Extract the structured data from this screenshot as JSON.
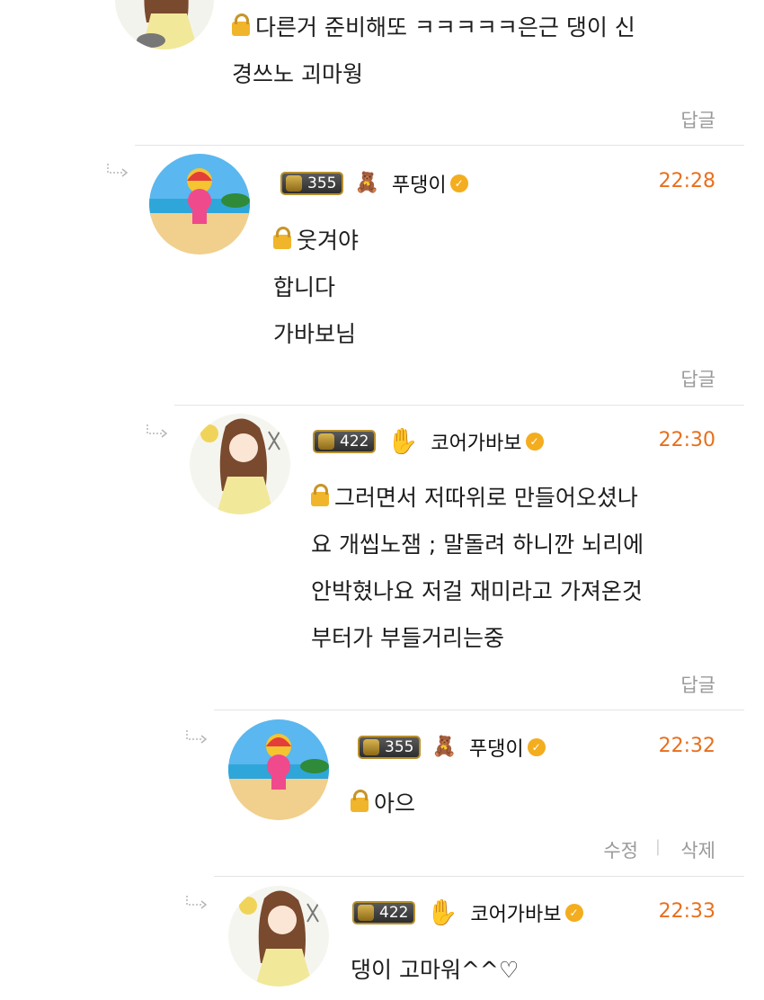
{
  "comments": [
    {
      "nickname": "",
      "time": "",
      "text_lines": [
        "다른거 준비해또 ㅋㅋㅋㅋㅋ은근 댕이 신",
        "경쓰노 괴마웡"
      ],
      "reply_label": "답글",
      "locked": true
    },
    {
      "level": "355",
      "rank_icon": "teddy-bear-icon",
      "nickname": "푸댕이",
      "time": "22:28",
      "text_lines": [
        "웃겨야",
        "합니다",
        "가바보님"
      ],
      "reply_label": "답글",
      "locked": true
    },
    {
      "level": "422",
      "rank_icon": "hand-icon",
      "nickname": "코어가바보",
      "time": "22:30",
      "text_lines": [
        "그러면서 저따위로 만들어오셨나",
        "요 개씹노잼 ; 말돌려 하니깐 뇌리에",
        "안박혔나요 저걸 재미라고 가져온것",
        "부터가 부들거리는중"
      ],
      "reply_label": "답글",
      "locked": true
    },
    {
      "level": "355",
      "rank_icon": "teddy-bear-icon",
      "nickname": "푸댕이",
      "time": "22:32",
      "text_lines": [
        "아으"
      ],
      "edit_label": "수정",
      "delete_label": "삭제",
      "locked": true
    },
    {
      "level": "422",
      "rank_icon": "hand-icon",
      "nickname": "코어가바보",
      "time": "22:33",
      "text_lines": [
        "댕이 고마워^^♡"
      ],
      "locked": false
    }
  ],
  "colors": {
    "time": "#e86f1c",
    "verified": "#f3ad1f",
    "lock": "#f0b52a",
    "action": "#9a9a9a"
  }
}
